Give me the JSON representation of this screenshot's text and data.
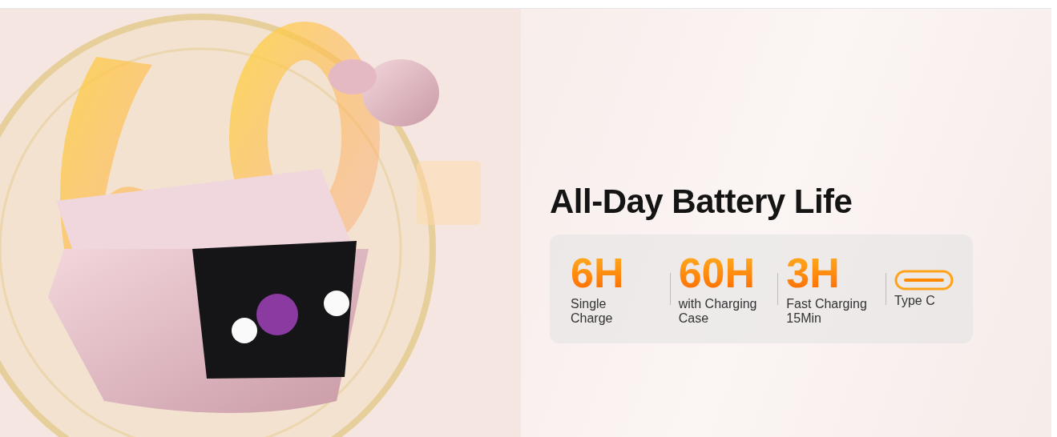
{
  "banner": {
    "kind": "picture",
    "title": "All-Day Battery Life",
    "features": [
      {
        "kind": "stat",
        "value": "6H",
        "label": "Single\nCharge"
      },
      {
        "kind": "stat",
        "value": "60H",
        "label": "with Charging\nCase"
      },
      {
        "kind": "stat",
        "value": "3H",
        "label": "Fast Charging\n15Min"
      },
      {
        "kind": "connector",
        "label": "Type C"
      }
    ]
  }
}
